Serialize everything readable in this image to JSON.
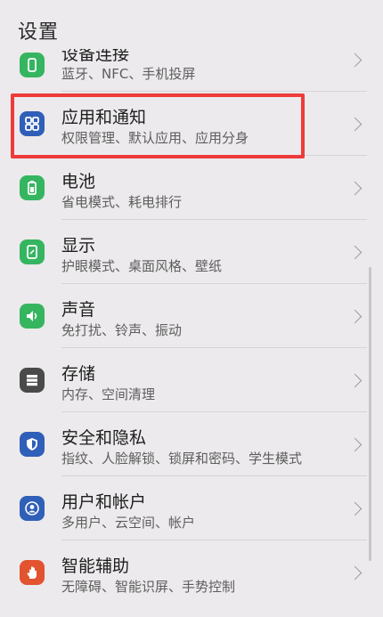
{
  "header": {
    "title": "设置"
  },
  "items": [
    {
      "label": "设备连接",
      "sub": "蓝牙、NFC、手机投屏",
      "icon": "device-connection-icon",
      "color": "#35b560"
    },
    {
      "label": "应用和通知",
      "sub": "权限管理、默认应用、应用分身",
      "icon": "apps-icon",
      "color": "#2f5fb8"
    },
    {
      "label": "电池",
      "sub": "省电模式、耗电排行",
      "icon": "battery-icon",
      "color": "#35b560"
    },
    {
      "label": "显示",
      "sub": "护眼模式、桌面风格、壁纸",
      "icon": "display-icon",
      "color": "#35b560"
    },
    {
      "label": "声音",
      "sub": "免打扰、铃声、振动",
      "icon": "sound-icon",
      "color": "#35b560"
    },
    {
      "label": "存储",
      "sub": "内存、空间清理",
      "icon": "storage-icon",
      "color": "#4a4a4a"
    },
    {
      "label": "安全和隐私",
      "sub": "指纹、人脸解锁、锁屏和密码、学生模式",
      "icon": "shield-icon",
      "color": "#2f5fb8"
    },
    {
      "label": "用户和帐户",
      "sub": "多用户、云空间、帐户",
      "icon": "user-icon",
      "color": "#2f5fb8"
    },
    {
      "label": "智能辅助",
      "sub": "无障碍、智能识屏、手势控制",
      "icon": "hand-icon",
      "color": "#e2532f"
    }
  ]
}
